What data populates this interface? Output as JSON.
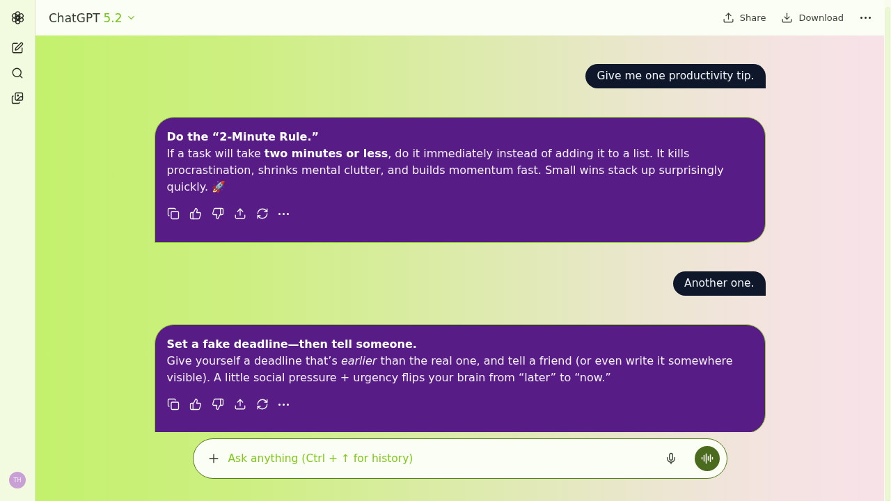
{
  "sidebar": {
    "avatar_initials": "TH"
  },
  "header": {
    "title": "ChatGPT",
    "version": "5.2",
    "actions": [
      {
        "kind": "share",
        "label": "Share"
      },
      {
        "kind": "download",
        "label": "Download"
      }
    ]
  },
  "messages": [
    {
      "kind": "user",
      "text": "Give me one productivity tip."
    },
    {
      "kind": "assistant",
      "heading": "Do the “2-Minute Rule.”",
      "text": "If a task will take **two minutes or less**, do it immediately instead of adding it to a list. It kills procrastination, shrinks mental clutter, and builds momentum fast. Small wins stack up surprisingly quickly. 🚀"
    },
    {
      "kind": "user",
      "text": "Another one."
    },
    {
      "kind": "assistant",
      "heading": "Set a fake deadline—then tell someone.",
      "text": "Give yourself a deadline that’s *earlier* than the real one, and tell a friend (or even write it somewhere visible). A little social pressure + urgency flips your brain from “later” to “now.”"
    }
  ],
  "composer": {
    "placeholder": "Ask anything (Ctrl + ↑ for history)"
  }
}
